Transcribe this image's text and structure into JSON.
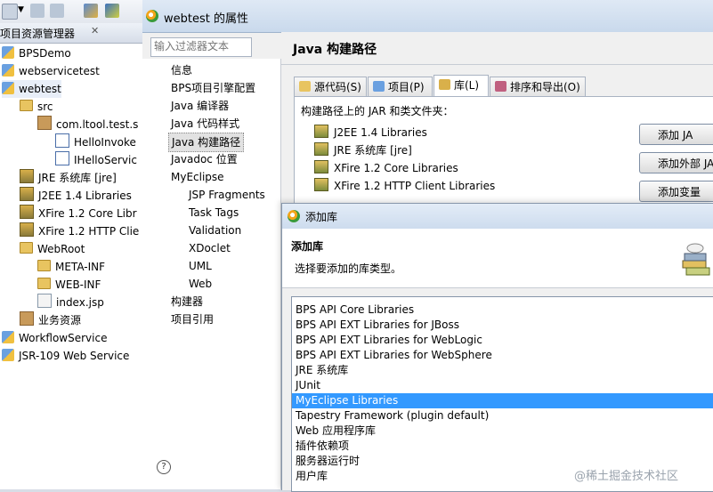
{
  "explorer": {
    "tab_title": "项目资源管理器",
    "close_glyph": "✕",
    "items": [
      {
        "label": "BPSDemo",
        "icon": "project-icon"
      },
      {
        "label": "webservicetest",
        "icon": "project-icon"
      },
      {
        "label": "webtest",
        "icon": "project-icon"
      },
      {
        "label": "src",
        "icon": "source-folder-icon"
      },
      {
        "label": "com.ltool.test.s",
        "icon": "package-icon"
      },
      {
        "label": "HelloInvoke",
        "icon": "java-file-icon"
      },
      {
        "label": "IHelloServic",
        "icon": "java-file-icon"
      },
      {
        "label": "JRE 系统库 [jre]",
        "icon": "library-icon"
      },
      {
        "label": "J2EE 1.4 Libraries",
        "icon": "library-icon"
      },
      {
        "label": "XFire 1.2 Core Libr",
        "icon": "library-icon"
      },
      {
        "label": "XFire 1.2 HTTP Clie",
        "icon": "library-icon"
      },
      {
        "label": "WebRoot",
        "icon": "folder-icon"
      },
      {
        "label": "META-INF",
        "icon": "folder-icon"
      },
      {
        "label": "WEB-INF",
        "icon": "folder-icon"
      },
      {
        "label": "index.jsp",
        "icon": "jsp-file-icon"
      },
      {
        "label": "业务资源",
        "icon": "resource-icon"
      },
      {
        "label": "WorkflowService",
        "icon": "project-icon"
      },
      {
        "label": "JSR-109 Web Service",
        "icon": "web-service-icon"
      }
    ]
  },
  "properties": {
    "title": "webtest 的属性",
    "filter_placeholder": "输入过滤器文本",
    "nav": [
      "信息",
      "BPS项目引擎配置",
      "Java 编译器",
      "Java 代码样式",
      "Java 构建路径",
      "Javadoc 位置",
      "MyEclipse",
      "JSP Fragments",
      "Task Tags",
      "Validation",
      "XDoclet",
      "UML",
      "Web",
      "构建器",
      "项目引用"
    ],
    "nav_selected": "Java 构建路径",
    "page_title": "Java 构建路径",
    "tabs": [
      {
        "label": "源代码(S)",
        "icon": "source-tab-icon"
      },
      {
        "label": "项目(P)",
        "icon": "project-tab-icon"
      },
      {
        "label": "库(L)",
        "icon": "library-tab-icon"
      },
      {
        "label": "排序和导出(O)",
        "icon": "order-export-tab-icon"
      }
    ],
    "active_tab": "库(L)",
    "jar_label": "构建路径上的 JAR 和类文件夹：",
    "jars": [
      "J2EE 1.4 Libraries",
      "JRE 系统库 [jre]",
      "XFire 1.2 Core Libraries",
      "XFire 1.2 HTTP Client Libraries"
    ],
    "buttons": [
      "添加 JA",
      "添加外部 JA",
      "添加变量"
    ],
    "help_glyph": "?"
  },
  "add_library": {
    "title": "添加库",
    "heading": "添加库",
    "description": "选择要添加的库类型。",
    "items": [
      "BPS API Core Libraries",
      "BPS API EXT Libraries for JBoss",
      "BPS API EXT Libraries for WebLogic",
      "BPS API EXT Libraries for WebSphere",
      "JRE 系统库",
      "JUnit",
      "MyEclipse Libraries",
      "Tapestry Framework (plugin default)",
      "Web 应用程序库",
      "插件依赖项",
      "服务器运行时",
      "用户库"
    ],
    "selected": "MyEclipse Libraries"
  },
  "watermark": "@稀土掘金技术社区"
}
